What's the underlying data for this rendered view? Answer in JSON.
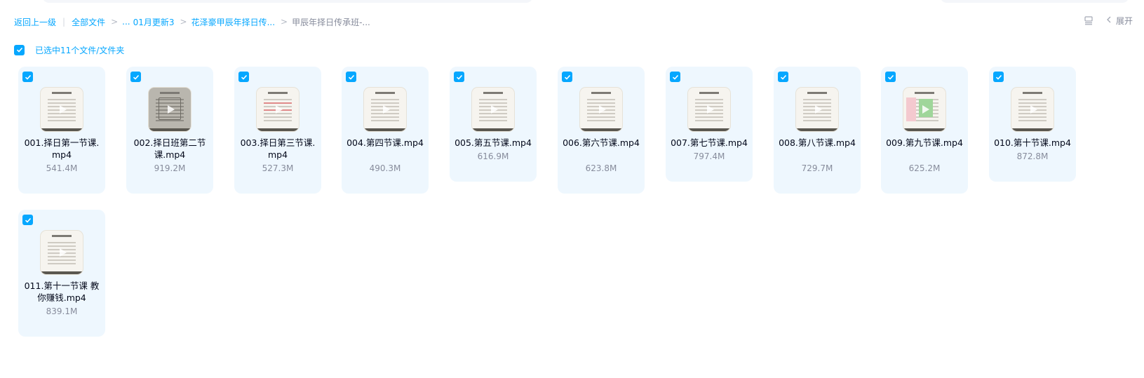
{
  "breadcrumb": {
    "back_label": "返回上一级",
    "sep_bar": "|",
    "root_label": "全部文件",
    "ellipsis": "...",
    "items": [
      "01月更新3",
      "花泽豪甲辰年择日传...",
      "甲辰年择日传承班-..."
    ],
    "sep_glyph": ">"
  },
  "toolbar": {
    "list_icon": "list-view-icon",
    "collapse_icon": "chevron-left-icon",
    "expand_label": "展开"
  },
  "selection": {
    "text": "已选中11个文件/文件夹",
    "checked": true,
    "accent": "#06a7ff"
  },
  "files": [
    {
      "name": "001.择日第一节课.mp4",
      "size": "541.4M",
      "checked": true,
      "thumb": "slide-light",
      "lines": 2
    },
    {
      "name": "002.择日班第二节课.mp4",
      "size": "919.2M",
      "checked": true,
      "thumb": "slide-dark",
      "lines": 2
    },
    {
      "name": "003.择日第三节课.mp4",
      "size": "527.3M",
      "checked": true,
      "thumb": "slide-red",
      "lines": 2
    },
    {
      "name": "004.第四节课.mp4",
      "size": "490.3M",
      "checked": true,
      "thumb": "slide-light",
      "lines": 2
    },
    {
      "name": "005.第五节课.mp4",
      "size": "616.9M",
      "checked": true,
      "thumb": "slide-light",
      "lines": 1
    },
    {
      "name": "006.第六节课.mp4",
      "size": "623.8M",
      "checked": true,
      "thumb": "slide-light",
      "lines": 2
    },
    {
      "name": "007.第七节课.mp4",
      "size": "797.4M",
      "checked": true,
      "thumb": "slide-light",
      "lines": 1
    },
    {
      "name": "008.第八节课.mp4",
      "size": "729.7M",
      "checked": true,
      "thumb": "slide-light",
      "lines": 2
    },
    {
      "name": "009.第九节课.mp4",
      "size": "625.2M",
      "checked": true,
      "thumb": "slide-pink",
      "lines": 2
    },
    {
      "name": "010.第十节课.mp4",
      "size": "872.8M",
      "checked": true,
      "thumb": "slide-light",
      "lines": 1
    },
    {
      "name": "011.第十一节课 教你赚钱.mp4",
      "size": "839.1M",
      "checked": true,
      "thumb": "slide-light",
      "lines": 2
    }
  ]
}
